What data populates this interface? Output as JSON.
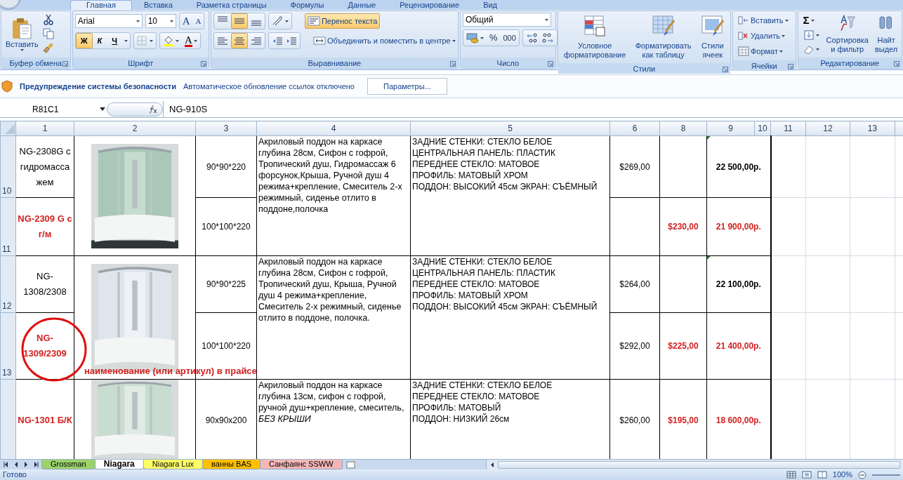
{
  "ribbon_tabs": [
    {
      "label": "Главная",
      "selected": true
    },
    {
      "label": "Вставка",
      "selected": false
    },
    {
      "label": "Разметка страницы",
      "selected": false
    },
    {
      "label": "Формулы",
      "selected": false
    },
    {
      "label": "Данные",
      "selected": false
    },
    {
      "label": "Рецензирование",
      "selected": false
    },
    {
      "label": "Вид",
      "selected": false
    }
  ],
  "clipboard": {
    "label": "Буфер обмена",
    "paste": "Вставить"
  },
  "font": {
    "label": "Шрифт",
    "name": "Arial",
    "size": "10",
    "grow": "A",
    "shrink": "A",
    "color_button": "A",
    "styles": [
      {
        "label": "Ж",
        "selected": true
      },
      {
        "label": "К",
        "selected": false
      },
      {
        "label": "Ч",
        "selected": false
      }
    ]
  },
  "alignment": {
    "label": "Выравнивание",
    "vertical": [
      {
        "selected": false
      },
      {
        "selected": true
      },
      {
        "selected": false
      }
    ],
    "horizontal": [
      {
        "selected": false
      },
      {
        "selected": true
      },
      {
        "selected": false
      }
    ],
    "wrap": {
      "label": "Перенос текста",
      "selected": true
    },
    "merge": "Объединить и поместить в центре"
  },
  "number": {
    "label": "Число",
    "format": "Общий",
    "percent": "%",
    "thousands": "000"
  },
  "styles": {
    "label": "Стили",
    "buttons": [
      {
        "lines": [
          "Условное",
          "форматирование"
        ]
      },
      {
        "lines": [
          "Форматировать",
          "как таблицу"
        ]
      },
      {
        "lines": [
          "Стили",
          "ячеек"
        ]
      }
    ]
  },
  "cells": {
    "label": "Ячейки",
    "buttons": [
      "Вставить",
      "Удалить",
      "Формат"
    ]
  },
  "editing": {
    "label": "Редактирование",
    "sigma": "Σ",
    "sort": [
      "Сортировка",
      "и фильтр"
    ],
    "find": [
      "Найт",
      "выдел"
    ]
  },
  "security_bar": {
    "title": "Предупреждение системы безопасности",
    "message": "Автоматическое обновление ссылок отключено",
    "button": "Параметры..."
  },
  "formula_bar": {
    "name_box": "R81C1",
    "formula": "NG-910S"
  },
  "columns": [
    "1",
    "2",
    "3",
    "4",
    "5",
    "6",
    "8",
    "9",
    "10",
    "11",
    "12",
    "13"
  ],
  "products": [
    {
      "photo": {
        "kind": "picture"
      },
      "description": "Акриловый поддон на каркасе глубина 28см, Сифон с гофрой, Тропический душ, Гидромассаж 6 форсунок,Крыша, Ручной душ 4 режима+крепление, Смеситель 2-х режимный, сиденье отлито в поддоне,полочка",
      "specs": [
        "ЗАДНИЕ СТЕНКИ: СТЕКЛО БЕЛОЕ",
        "ЦЕНТРАЛЬНАЯ ПАНЕЛЬ: ПЛАСТИК",
        "ПЕРЕДНЕЕ СТЕКЛО: МАТОВОЕ",
        "ПРОФИЛЬ: МАТОВЫЙ ХРОМ",
        "ПОДДОН: ВЫСОКИЙ 45см ЭКРАН: СЪЁМНЫЙ"
      ],
      "variants": [
        {
          "row": "10",
          "model": "NG-2308G с гидромассажем",
          "size": "90*90*220",
          "usd": "$269,00",
          "rub": "22 500,00р.",
          "promo": false,
          "error_indicator": true
        },
        {
          "row": "11",
          "model": "NG-2309 G с г/м",
          "size": "100*100*220",
          "sale": "$230,00",
          "rub": "21 900,00р.",
          "promo": true,
          "error_indicator": false
        }
      ]
    },
    {
      "photo": {
        "kind": "picture"
      },
      "description": "Акриловый поддон на каркасе глубина 28см, Сифон с гофрой, Тропический душ, Крыша, Ручной душ 4 режима+крепление, Смеситель 2-х режимный, сиденье отлито в поддоне, полочка.",
      "specs": [
        "ЗАДНИЕ СТЕНКИ: СТЕКЛО БЕЛОЕ",
        "ЦЕНТРАЛЬНАЯ ПАНЕЛЬ: ПЛАСТИК",
        "ПЕРЕДНЕЕ СТЕКЛО: МАТОВОЕ",
        "ПРОФИЛЬ: МАТОВЫЙ ХРОМ",
        "ПОДДОН: ВЫСОКИЙ 45см ЭКРАН: СЪЁМНЫЙ"
      ],
      "variants": [
        {
          "row": "12",
          "model": "NG-1308/2308",
          "size": "90*90*225",
          "usd": "$264,00",
          "rub": "22 100,00р.",
          "promo": false,
          "error_indicator": true
        },
        {
          "row": "13",
          "model": "NG-1309/2309",
          "size": "100*100*220",
          "usd": "$292,00",
          "sale": "$225,00",
          "rub": "21 400,00р.",
          "promo": true,
          "error_indicator": false
        }
      ]
    },
    {
      "photo": {
        "kind": "picture"
      },
      "description": "Акриловый поддон на каркасе глубина 13см, сифон с гофрой, ручной душ+крепление, смеситель, *БЕЗ КРЫШИ*",
      "specs": [
        "ЗАДНИЕ СТЕНКИ: СТЕКЛО БЕЛОЕ",
        "ПЕРЕДНЕЕ СТЕКЛО: МАТОВОЕ",
        "ПРОФИЛЬ: МАТОВЫЙ",
        "ПОДДОН: НИЗКИЙ 26см"
      ],
      "variants": [
        {
          "model": "NG-1301 Б/К",
          "size": "90x90x200",
          "usd": "$260,00",
          "sale": "$195,00",
          "rub": "18 600,00р.",
          "promo": true,
          "error_indicator": false
        }
      ]
    }
  ],
  "annotation": {
    "text": "наименование (или артикул) в прайсе"
  },
  "sheet_tabs": [
    {
      "label": "Grossman",
      "color": "#9bd36a",
      "selected": false
    },
    {
      "label": "Niagara",
      "color": "#ffffff",
      "selected": true
    },
    {
      "label": "Niagara Lux",
      "color": "#ffff66",
      "selected": false
    },
    {
      "label": "ванны BAS",
      "color": "#ffc000",
      "selected": false
    },
    {
      "label": "Санфаянс SSWW",
      "color": "#f4b6b6",
      "selected": false
    }
  ],
  "status_bar": {
    "text": "Готово",
    "zoom": "100%"
  }
}
